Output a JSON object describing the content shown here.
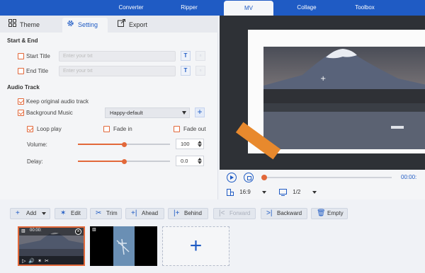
{
  "topnav": {
    "tabs": [
      {
        "label": "Converter"
      },
      {
        "label": "Ripper"
      },
      {
        "label": "MV"
      },
      {
        "label": "Collage"
      },
      {
        "label": "Toolbox"
      }
    ]
  },
  "subtabs": {
    "theme": "Theme",
    "setting": "Setting",
    "export": "Export"
  },
  "start_end": {
    "title": "Start & End",
    "start_title_label": "Start Title",
    "start_title_placeholder": "Enter your txt",
    "end_title_label": "End Title",
    "end_title_placeholder": "Enter your txt",
    "text_icon": "T"
  },
  "audio": {
    "title": "Audio Track",
    "keep_original": "Keep original audio track",
    "background_music": "Background Music",
    "music_selected": "Happy-default",
    "loop_play": "Loop play",
    "fade_in": "Fade in",
    "fade_out": "Fade out",
    "volume_label": "Volume:",
    "volume_value": "100",
    "volume_level": 0.5,
    "delay_label": "Delay:",
    "delay_value": "0.0",
    "delay_level": 0.5
  },
  "player": {
    "timecode": "00:00:",
    "aspect": "16:9",
    "screen": "1/2",
    "progress": 0.0
  },
  "toolbar": {
    "add": "Add",
    "edit": "Edit",
    "trim": "Trim",
    "ahead": "Ahead",
    "behind": "Behind",
    "forward": "Forward",
    "backward": "Backward",
    "empty": "Empty"
  },
  "timeline": {
    "clip1_time": "00:00:",
    "add_symbol": "+"
  },
  "colors": {
    "accent_blue": "#1f5bc4",
    "accent_orange": "#e2683a"
  }
}
